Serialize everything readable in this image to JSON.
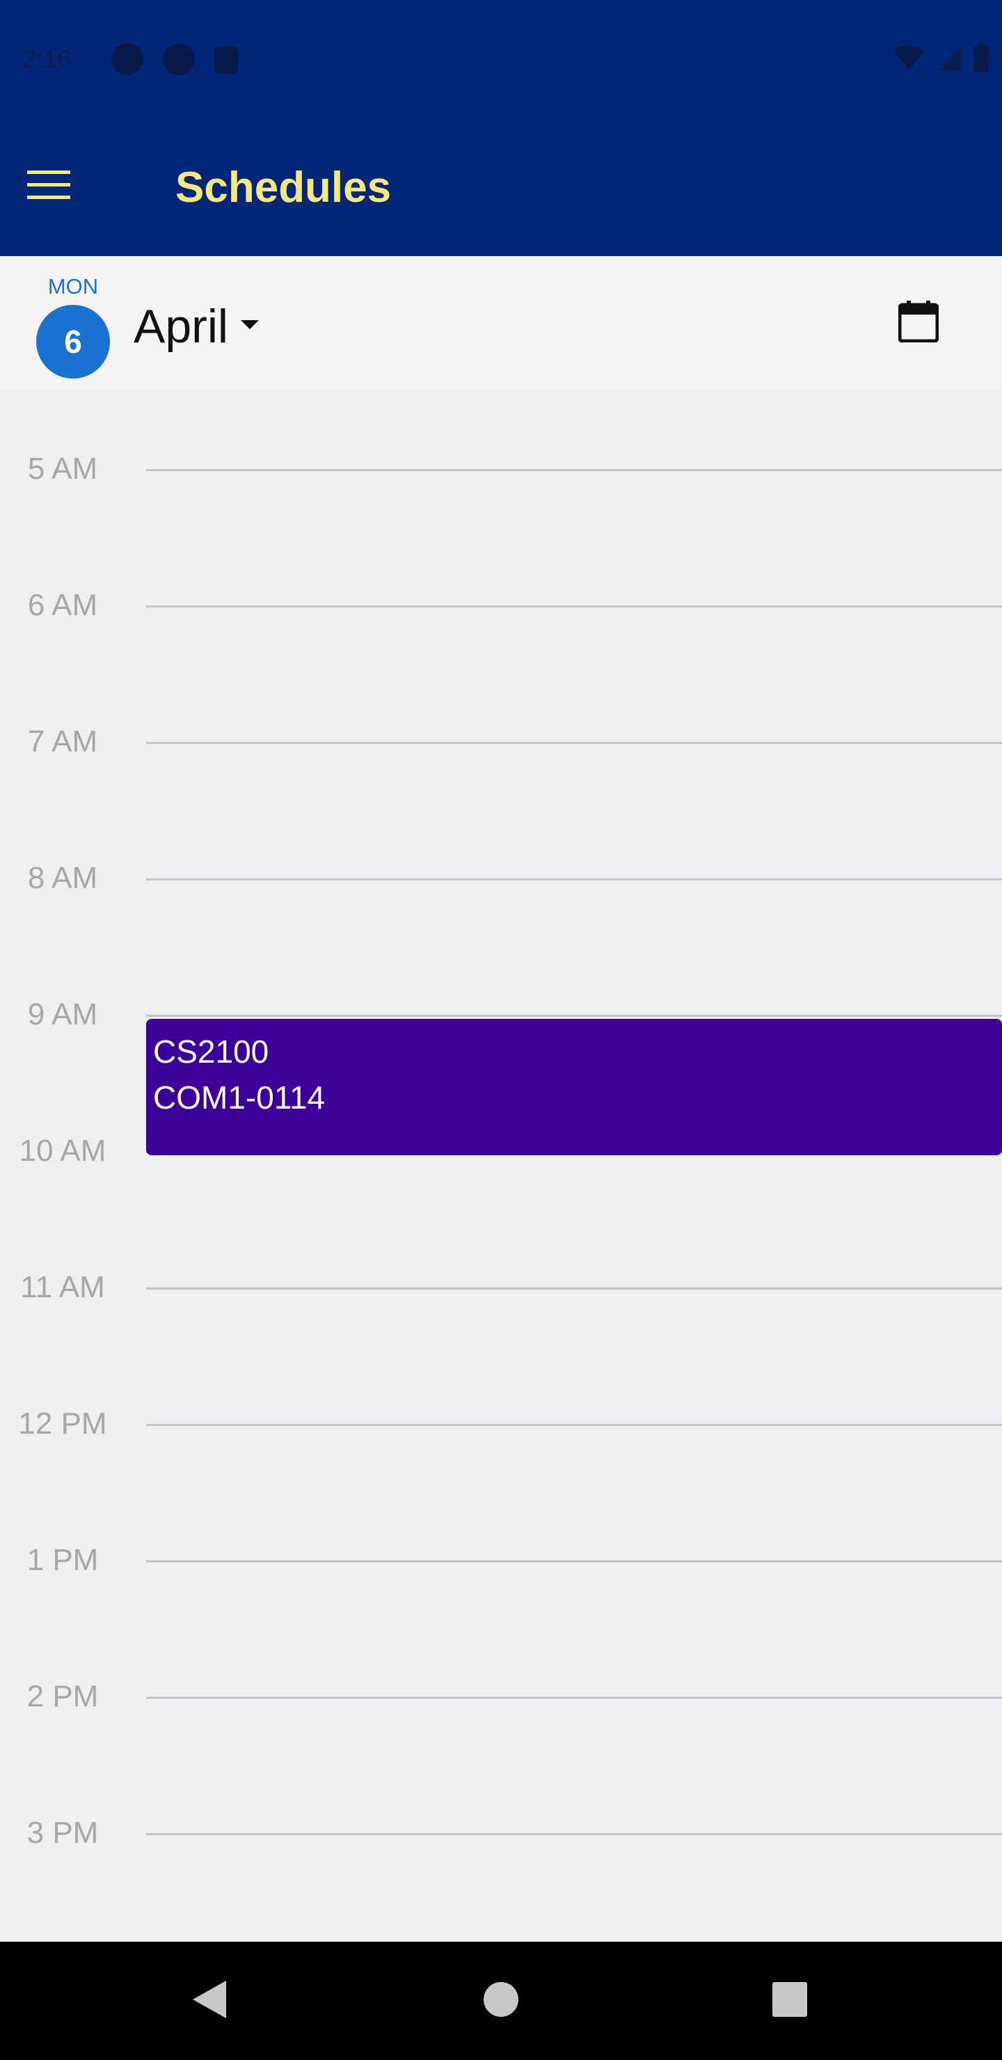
{
  "status_bar": {
    "time": "2:16",
    "background": "#022778",
    "left_icons": [
      "notification-icon",
      "notification-icon",
      "sd-card-icon"
    ],
    "right_icons": [
      "wifi-icon",
      "signal-icon",
      "battery-icon"
    ]
  },
  "app_bar": {
    "menu_icon": "hamburger-menu-icon",
    "title": "Schedules",
    "title_color": "#f5e97d",
    "background": "#022778"
  },
  "date_header": {
    "day_abbr": "MON",
    "day_number": "6",
    "month": "April",
    "month_dropdown_icon": "caret-down-icon",
    "calendar_icon": "calendar-icon",
    "accent": "#1a73d3"
  },
  "timeline": {
    "hours": [
      "5 AM",
      "6 AM",
      "7 AM",
      "8 AM",
      "9 AM",
      "10 AM",
      "11 AM",
      "12 PM",
      "1 PM",
      "2 PM",
      "3 PM"
    ],
    "events": [
      {
        "title": "CS2100",
        "location": "COM1-0114",
        "start": "9 AM",
        "end": "10 AM",
        "color": "#3d0099"
      }
    ]
  },
  "nav_bar": {
    "back_icon": "back-triangle-icon",
    "home_icon": "home-circle-icon",
    "recents_icon": "recents-square-icon"
  }
}
